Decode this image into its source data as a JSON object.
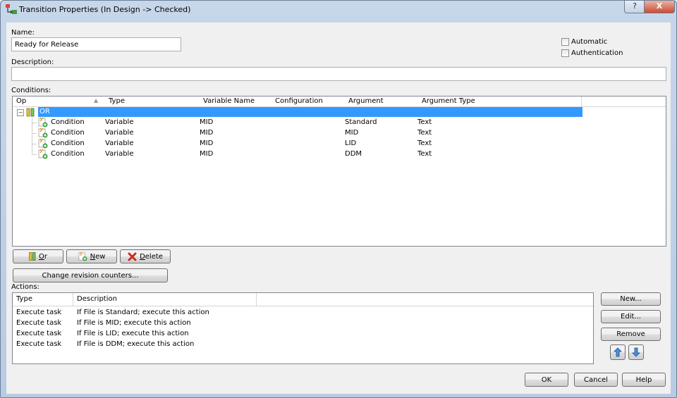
{
  "window": {
    "title": "Transition Properties (In Design -> Checked)",
    "help_glyph": "?",
    "close_glyph": "X"
  },
  "form": {
    "name_label": "Name:",
    "name_value": "Ready for Release",
    "description_label": "Description:",
    "description_value": "",
    "automatic_label": "Automatic",
    "automatic_checked": false,
    "authentication_label": "Authentication",
    "authentication_checked": false
  },
  "conditions": {
    "label": "Conditions:",
    "columns": [
      "Op",
      "Type",
      "Variable Name",
      "Configuration",
      "Argument",
      "Argument Type"
    ],
    "sort_glyph": "▲",
    "tree_toggle": "−",
    "root": {
      "op": "OR"
    },
    "rows": [
      {
        "op": "Condition",
        "type": "Variable",
        "variable_name": "MID",
        "configuration": "",
        "argument": "Standard",
        "argument_type": "Text"
      },
      {
        "op": "Condition",
        "type": "Variable",
        "variable_name": "MID",
        "configuration": "",
        "argument": "MID",
        "argument_type": "Text"
      },
      {
        "op": "Condition",
        "type": "Variable",
        "variable_name": "MID",
        "configuration": "",
        "argument": "LID",
        "argument_type": "Text"
      },
      {
        "op": "Condition",
        "type": "Variable",
        "variable_name": "MID",
        "configuration": "",
        "argument": "DDM",
        "argument_type": "Text"
      }
    ],
    "or_button": {
      "hotkey": "O",
      "rest": "r"
    },
    "new_button": {
      "hotkey": "N",
      "rest": "ew"
    },
    "delete_button": {
      "hotkey": "D",
      "rest": "elete"
    },
    "change_revision_label": "Change revision counters..."
  },
  "actions": {
    "label": "Actions:",
    "columns": [
      "Type",
      "Description"
    ],
    "rows": [
      {
        "type": "Execute task",
        "description": "If File is Standard; execute this action"
      },
      {
        "type": "Execute task",
        "description": "If File is MID; execute this action"
      },
      {
        "type": "Execute task",
        "description": "If File is LID; execute this action"
      },
      {
        "type": "Execute task",
        "description": "If File is DDM; execute this action"
      }
    ],
    "new_label": "New...",
    "edit_label": "Edit...",
    "remove_label": "Remove"
  },
  "footer": {
    "ok_label": "OK",
    "cancel_label": "Cancel",
    "help_label": "Help"
  },
  "colors": {
    "selection": "#3399ff",
    "accent": "#1a5fb4"
  }
}
